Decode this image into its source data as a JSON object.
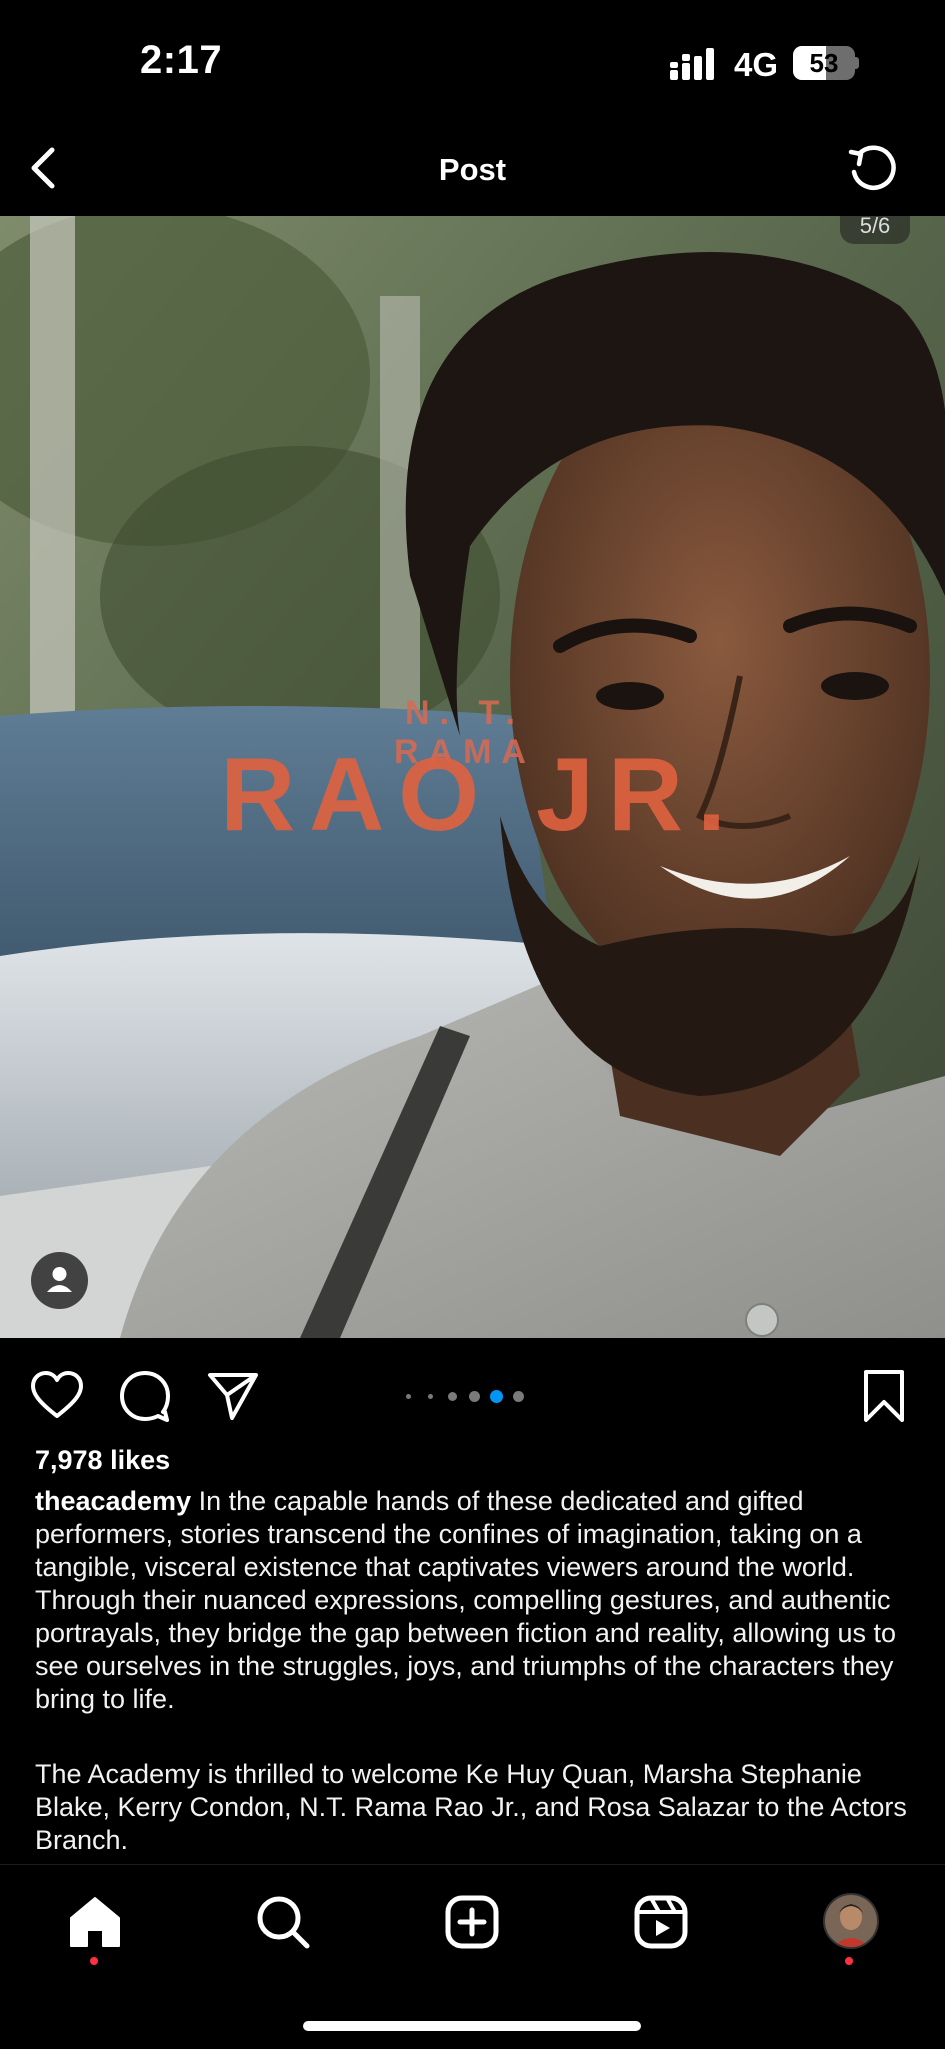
{
  "status_bar": {
    "time": "2:17",
    "network": "4G",
    "battery_level": "53",
    "battery_fraction": 0.53
  },
  "nav": {
    "title": "Post",
    "back_icon": "chevron-left-icon",
    "refresh_icon": "refresh-icon"
  },
  "media": {
    "overlay_small": "N. T. RAMA",
    "overlay_big": "RAO JR.",
    "counter": "5/6",
    "carousel_total": 6,
    "carousel_active": 5
  },
  "actions": {
    "like_icon": "heart-icon",
    "comment_icon": "comment-icon",
    "share_icon": "send-icon",
    "save_icon": "bookmark-icon"
  },
  "likes": "7,978 likes",
  "caption": {
    "username": "theacademy",
    "text": "In the capable hands of these dedicated and gifted performers, stories transcend the confines of imagination, taking on a tangible, visceral existence that captivates viewers around the world. Through their nuanced expressions, compelling gestures, and authentic portrayals, they bridge the gap between fiction and reality, allowing us to see ourselves in the struggles, joys, and triumphs of the characters they bring to life.",
    "text2": "The Academy is thrilled to welcome Ke Huy Quan, Marsha Stephanie Blake, Kerry Condon, N.T. Rama Rao Jr., and Rosa Salazar to the Actors Branch."
  },
  "tabbar": {
    "items": [
      "home-icon",
      "search-icon",
      "create-icon",
      "reels-icon",
      "profile-avatar"
    ],
    "accent": "#ff3040",
    "active_dot_color": "#0095f6"
  }
}
